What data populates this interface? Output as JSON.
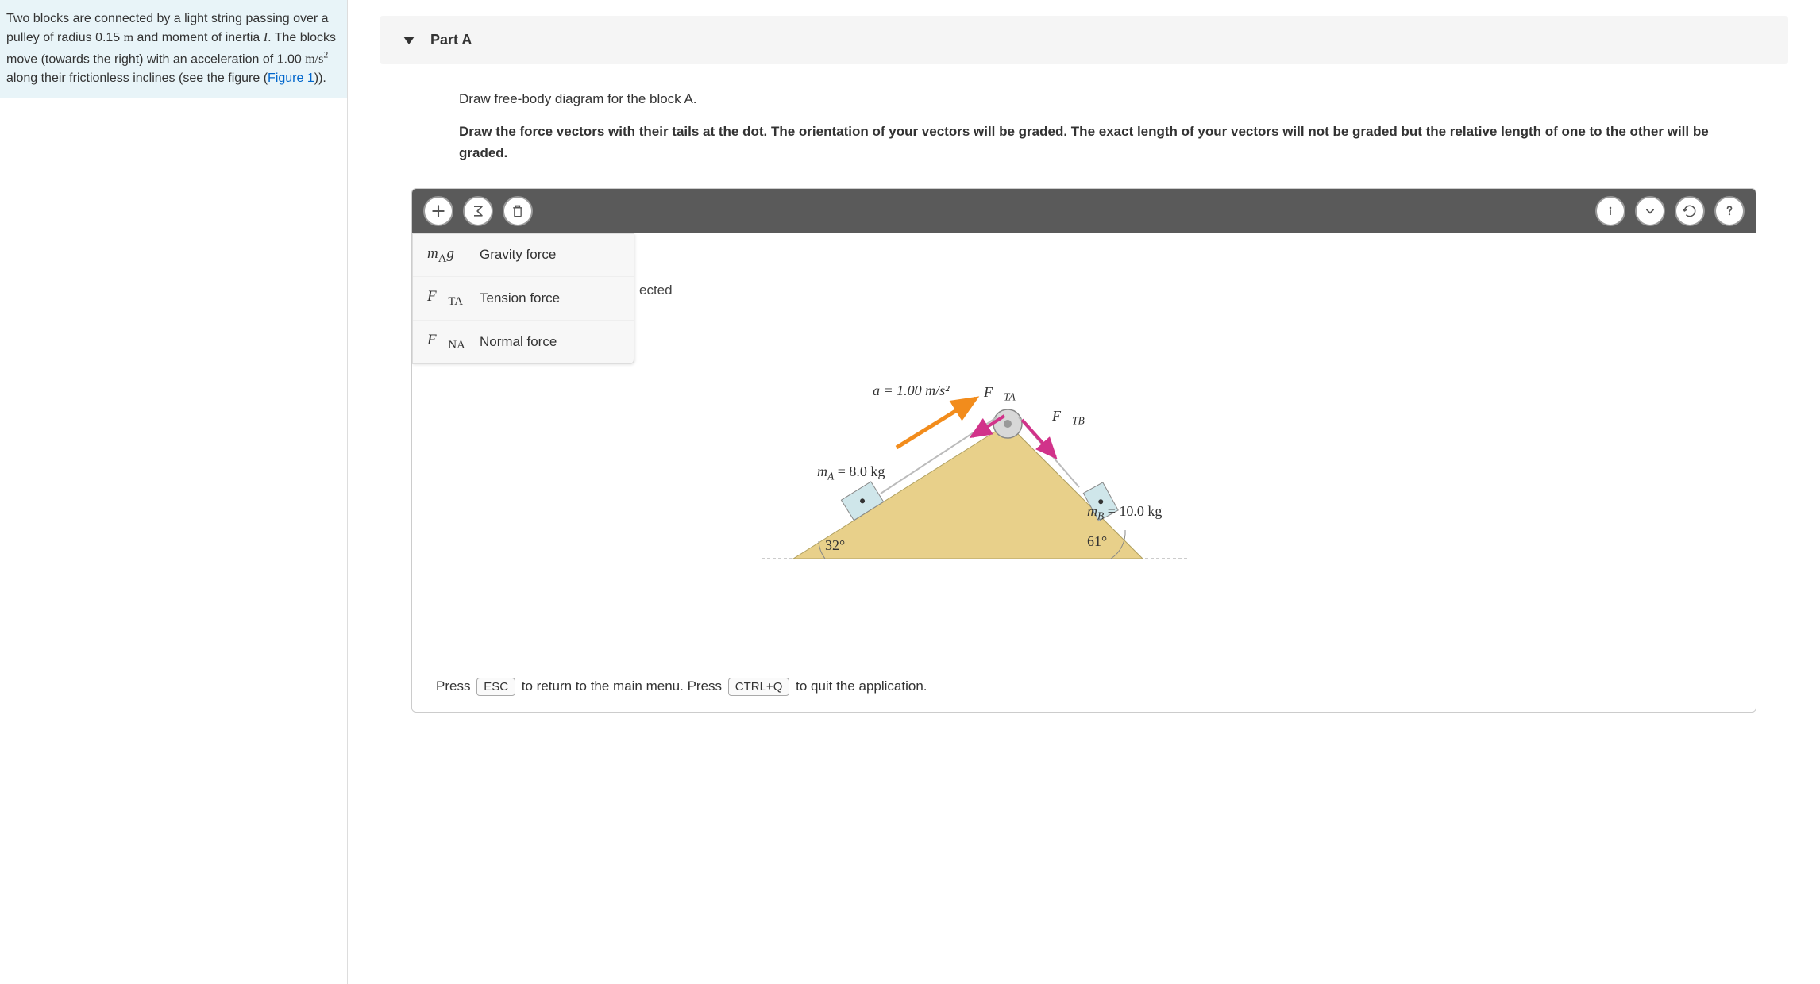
{
  "problem": {
    "text_before_I": "Two blocks are connected by a light string passing over a pulley of radius 0.15 ",
    "radius_unit": "m",
    "text_moment": " and moment of inertia ",
    "I_var": "I",
    "text_after_I": ". The blocks move (towards the right) with an acceleration of 1.00 ",
    "accel_unit": "m/s",
    "accel_exp": "2",
    "text_after_accel": " along their frictionless inclines (see the figure (",
    "figure_link": "Figure 1",
    "text_end": "))."
  },
  "part": {
    "title": "Part A",
    "instruction1": "Draw free-body diagram for the block A.",
    "instruction2": "Draw the force vectors with their tails at the dot. The orientation of your vectors will be graded. The exact length of your vectors will not be graded but the relative length of one to the other will be graded."
  },
  "forces": [
    {
      "symbol_pre": "m",
      "symbol_sub": "A",
      "symbol_post": "g⃗",
      "label": "Gravity force"
    },
    {
      "symbol_pre": "F⃗",
      "symbol_sub": "TA",
      "symbol_post": "",
      "label": "Tension force"
    },
    {
      "symbol_pre": "F⃗",
      "symbol_sub": "NA",
      "symbol_post": "",
      "label": "Normal force"
    }
  ],
  "text_behind": "ected",
  "diagram": {
    "accel_label": "a = 1.00 m/s²",
    "fta_label": "F⃗",
    "fta_sub": "TA",
    "ftb_label": "F⃗",
    "ftb_sub": "TB",
    "ma_label": "m",
    "ma_sub": "A",
    "ma_val": " = 8.0 kg",
    "mb_label": "m",
    "mb_sub": "B",
    "mb_val": " = 10.0 kg",
    "angle_left": "32°",
    "angle_right": "61°"
  },
  "footer": {
    "press": "Press ",
    "esc": "ESC",
    "mid": " to return to the main menu. Press ",
    "ctrlq": "CTRL+Q",
    "end": " to quit the application."
  }
}
